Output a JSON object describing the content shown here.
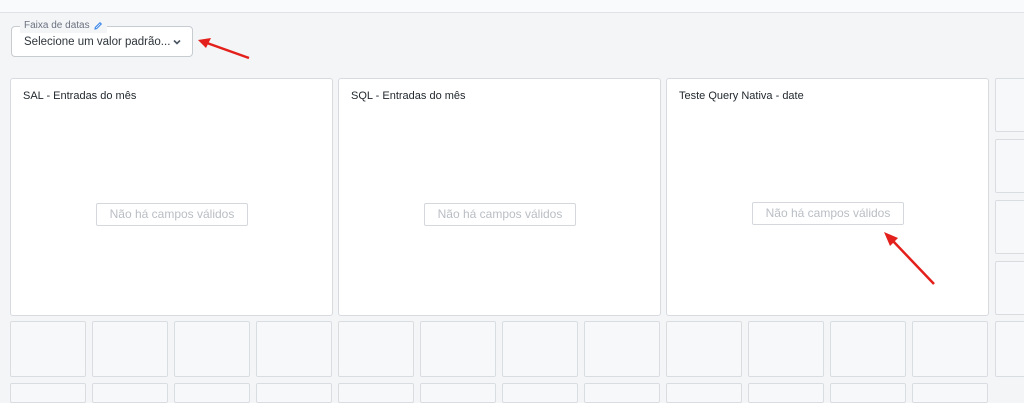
{
  "filter": {
    "label": "Faixa de datas",
    "value": "Selecione um valor padrão...",
    "label_icon": "pencil-icon",
    "dropdown_icon": "chevron-down-icon"
  },
  "cards": [
    {
      "title": "SAL - Entradas do mês",
      "empty_message": "Não há campos válidos"
    },
    {
      "title": "SQL - Entradas do mês",
      "empty_message": "Não há campos válidos"
    },
    {
      "title": "Teste Query Nativa - date",
      "empty_message": "Não há campos válidos"
    }
  ],
  "annotations": {
    "arrow_color": "#e3201b"
  }
}
